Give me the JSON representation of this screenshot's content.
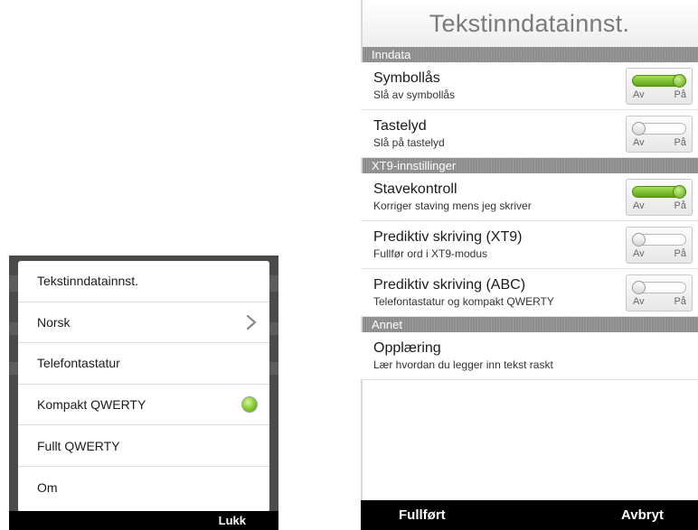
{
  "left_menu": {
    "items": [
      {
        "label": "Tekstinndatainnst.",
        "type": "plain"
      },
      {
        "label": "Norsk",
        "type": "submenu",
        "icon": "chevron-right-icon"
      },
      {
        "label": "Telefontastatur",
        "type": "radio",
        "selected": false
      },
      {
        "label": "Kompakt QWERTY",
        "type": "radio",
        "selected": true,
        "icon": "radio-selected-icon"
      },
      {
        "label": "Fullt QWERTY",
        "type": "radio",
        "selected": false
      },
      {
        "label": "Om",
        "type": "plain"
      }
    ],
    "close_label": "Lukk"
  },
  "settings": {
    "title": "Tekstinndatainnst.",
    "sections": [
      {
        "header": "Inndata",
        "rows": [
          {
            "title": "Symbollås",
            "subtitle": "Slå av symbollås",
            "toggle_on": true
          },
          {
            "title": "Tastelyd",
            "subtitle": "Slå på tastelyd",
            "toggle_on": false
          }
        ]
      },
      {
        "header": "XT9-innstillinger",
        "rows": [
          {
            "title": "Stavekontroll",
            "subtitle": "Korriger staving mens jeg skriver",
            "toggle_on": true
          },
          {
            "title": "Prediktiv skriving (XT9)",
            "subtitle": "Fullfør ord i XT9-modus",
            "toggle_on": false
          },
          {
            "title": "Prediktiv skriving (ABC)",
            "subtitle": "Telefontastatur og kompakt QWERTY",
            "toggle_on": false
          }
        ]
      },
      {
        "header": "Annet",
        "rows": [
          {
            "title": "Opplæring",
            "subtitle": "Lær hvordan du legger inn tekst raskt"
          }
        ]
      }
    ],
    "toggle_labels": {
      "off": "Av",
      "on": "På"
    },
    "done_label": "Fullført",
    "cancel_label": "Avbryt"
  },
  "colors": {
    "toggle_on": "#6fb522",
    "section_header_bg": "#8d8d8d",
    "bottom_bar": "#000000"
  }
}
